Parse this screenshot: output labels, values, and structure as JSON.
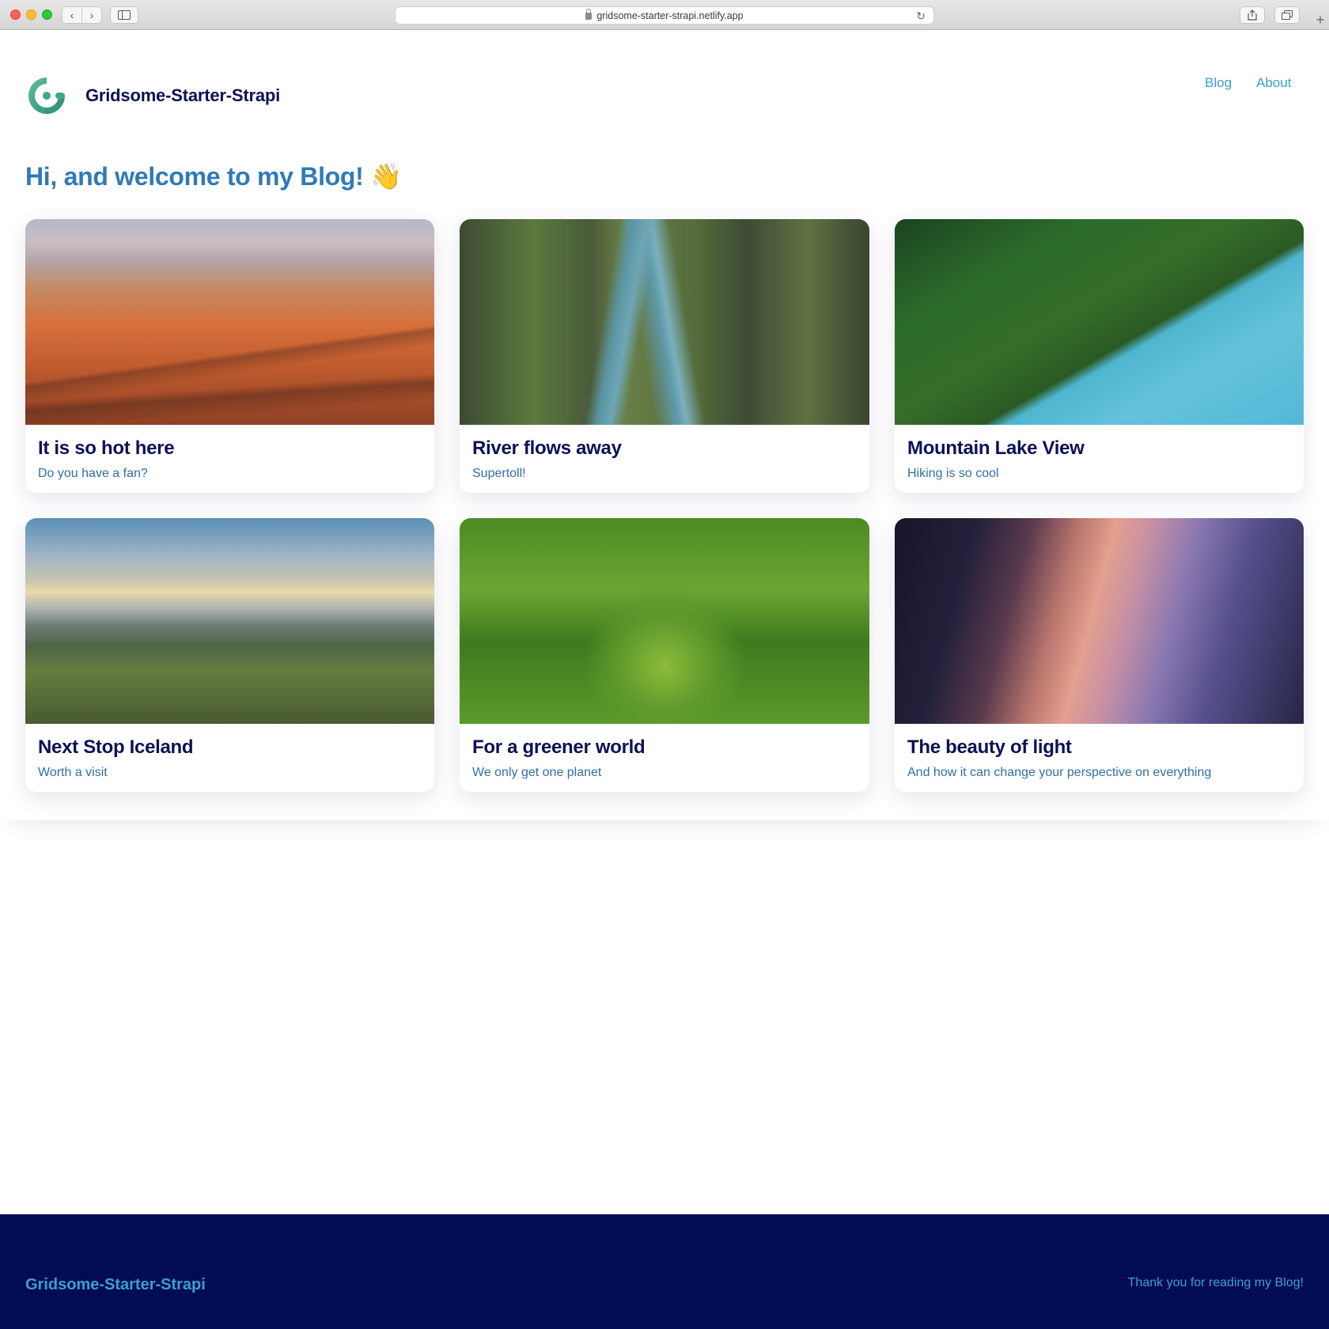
{
  "browser": {
    "url": "gridsome-starter-strapi.netlify.app"
  },
  "header": {
    "site_title": "Gridsome-Starter-Strapi",
    "nav": [
      {
        "label": "Blog"
      },
      {
        "label": "About"
      }
    ]
  },
  "welcome": "Hi, and welcome to my Blog! 👋",
  "posts": [
    {
      "title": "It is so hot here",
      "subtitle": "Do you have a fan?"
    },
    {
      "title": "River flows away",
      "subtitle": "Supertoll!"
    },
    {
      "title": "Mountain Lake View",
      "subtitle": "Hiking is so cool"
    },
    {
      "title": "Next Stop Iceland",
      "subtitle": "Worth a visit"
    },
    {
      "title": "For a greener world",
      "subtitle": "We only get one planet"
    },
    {
      "title": "The beauty of light",
      "subtitle": "And how it can change your perspective on everything"
    }
  ],
  "footer": {
    "title": "Gridsome-Starter-Strapi",
    "note": "Thank you for reading my Blog!"
  },
  "colors": {
    "title_navy": "#0d1155",
    "link_blue": "#3aa1cf",
    "welcome_blue": "#2f7ab8",
    "footer_bg": "#020b55"
  }
}
